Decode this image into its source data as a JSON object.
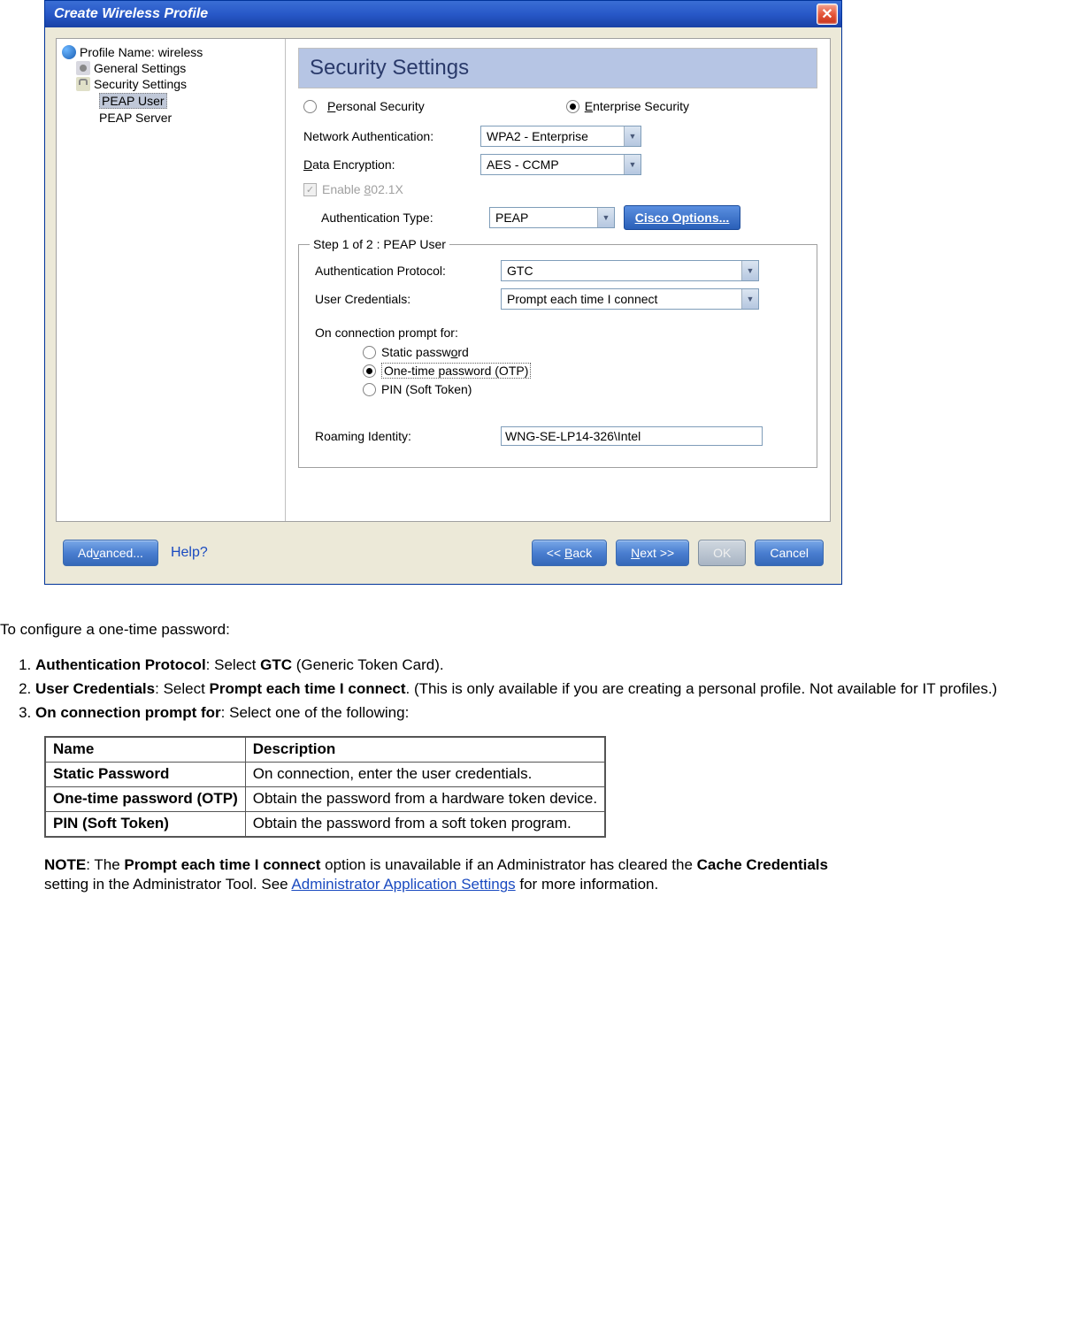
{
  "window": {
    "title": "Create Wireless Profile"
  },
  "tree": {
    "root": "Profile Name: wireless",
    "general": "General Settings",
    "security": "Security Settings",
    "peap_user": "PEAP User",
    "peap_server": "PEAP Server"
  },
  "heading": "Security Settings",
  "security_type": {
    "personal": "Personal Security",
    "enterprise": "Enterprise Security"
  },
  "fields": {
    "network_auth_label": "Network Authentication:",
    "network_auth_value": "WPA2 - Enterprise",
    "data_enc_label": "Data Encryption:",
    "data_enc_value": "AES - CCMP",
    "enable_8021x": "Enable 802.1X",
    "auth_type_label": "Authentication Type:",
    "auth_type_value": "PEAP",
    "cisco_button": "Cisco Options..."
  },
  "step": {
    "legend": "Step 1 of 2 : PEAP User",
    "auth_proto_label": "Authentication Protocol:",
    "auth_proto_value": "GTC",
    "user_cred_label": "User Credentials:",
    "user_cred_value": "Prompt each time I connect",
    "prompt_label": "On connection prompt for:",
    "static_pw": "Static password",
    "otp": "One-time password (OTP)",
    "pin": "PIN (Soft Token)",
    "roaming_label": "Roaming Identity:",
    "roaming_value": "WNG-SE-LP14-326\\Intel"
  },
  "buttons": {
    "advanced": "Advanced...",
    "help": "Help?",
    "back": "<< Back",
    "next": "Next >>",
    "ok": "OK",
    "cancel": "Cancel"
  },
  "doc": {
    "intro": "To configure a one-time password:",
    "li1a": "Authentication Protocol",
    "li1b": ": Select ",
    "li1c": "GTC",
    "li1d": " (Generic Token Card).",
    "li2a": "User Credentials",
    "li2b": ": Select ",
    "li2c": "Prompt each time I connect",
    "li2d": ". (This is only available if you are creating a personal profile. Not available for IT profiles.)",
    "li3a": "On connection prompt for",
    "li3b": ": Select one of the following:",
    "th_name": "Name",
    "th_desc": "Description",
    "r1n": "Static Password",
    "r1d": "On connection, enter the user credentials.",
    "r2n": "One-time password (OTP)",
    "r2d": "Obtain the password from a hardware token device.",
    "r3n": "PIN (Soft Token)",
    "r3d": "Obtain the password from a soft token program.",
    "note_a": "NOTE",
    "note_b": ": The ",
    "note_c": "Prompt each time I connect",
    "note_d": " option is unavailable if an Administrator has cleared the ",
    "note_e": "Cache Credentials",
    "note_f": " setting in the Administrator Tool. See ",
    "note_link": "Administrator Application Settings",
    "note_g": " for more information."
  }
}
